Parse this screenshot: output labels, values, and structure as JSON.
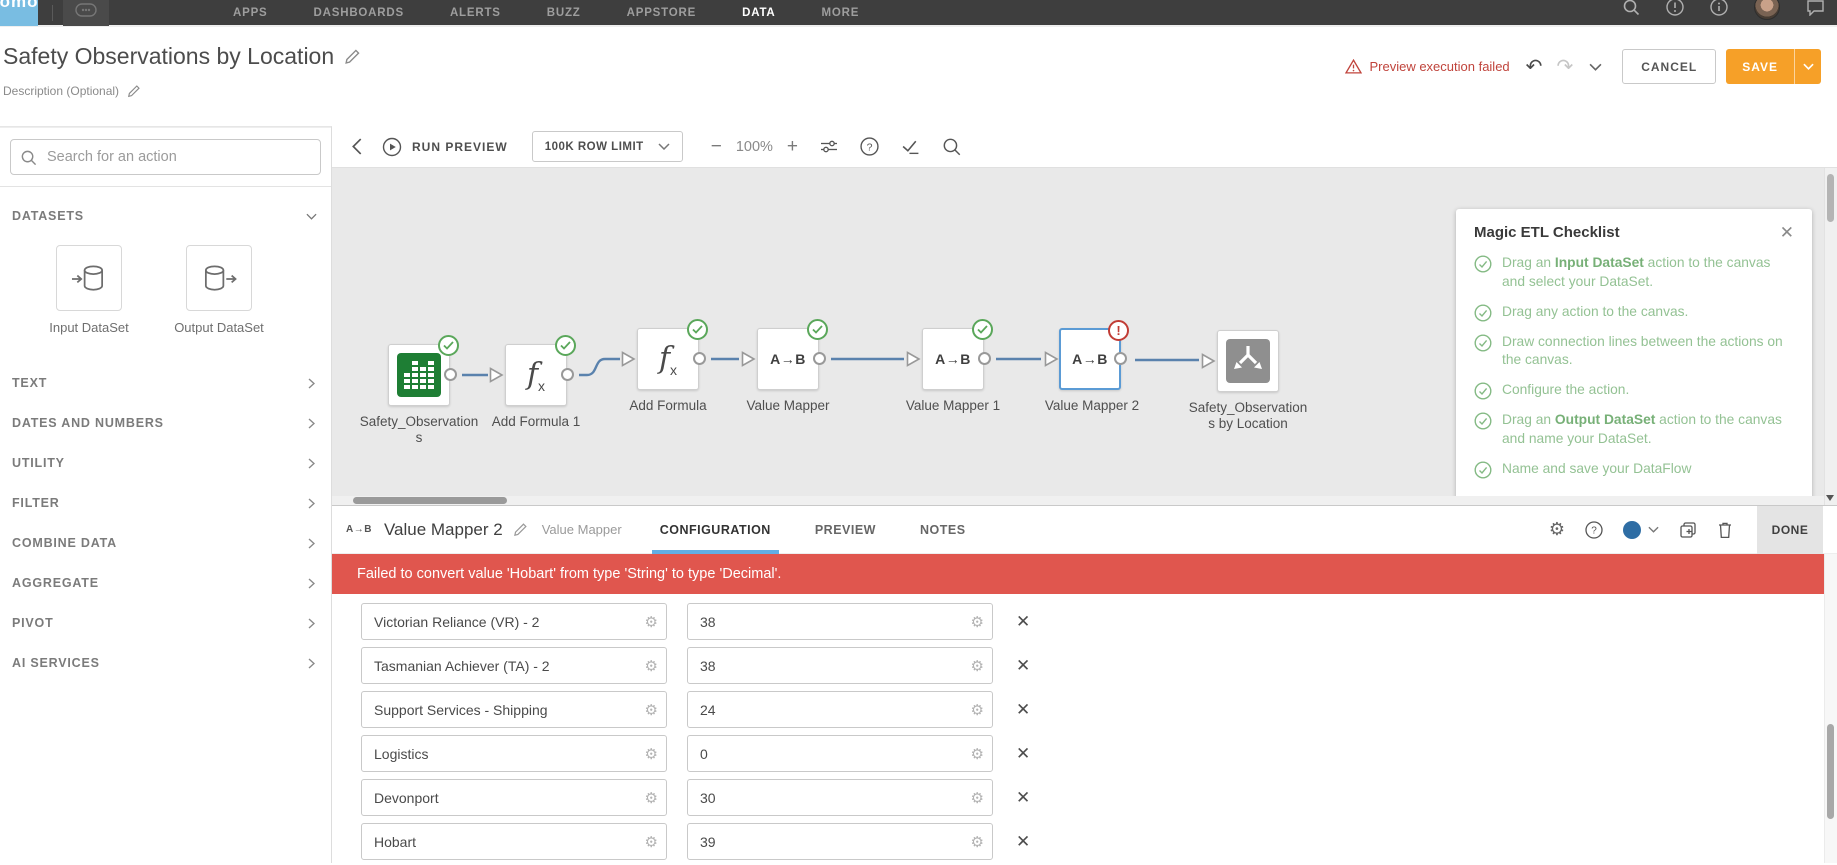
{
  "topnav": {
    "items": [
      {
        "label": "APPS",
        "active": false
      },
      {
        "label": "DASHBOARDS",
        "active": false
      },
      {
        "label": "ALERTS",
        "active": false
      },
      {
        "label": "BUZZ",
        "active": false
      },
      {
        "label": "APPSTORE",
        "active": false
      },
      {
        "label": "DATA",
        "active": true
      },
      {
        "label": "MORE",
        "active": false
      }
    ]
  },
  "header": {
    "title": "Safety Observations by Location",
    "description_label": "Description (Optional)",
    "error_status": "Preview execution failed",
    "cancel_label": "CANCEL",
    "save_label": "SAVE"
  },
  "sidebar": {
    "search_placeholder": "Search for an action",
    "datasets": {
      "label": "DATASETS",
      "tiles": [
        {
          "label": "Input DataSet",
          "type": "input"
        },
        {
          "label": "Output DataSet",
          "type": "output"
        }
      ]
    },
    "sections": [
      "TEXT",
      "DATES AND NUMBERS",
      "UTILITY",
      "FILTER",
      "COMBINE DATA",
      "AGGREGATE",
      "PIVOT",
      "AI SERVICES"
    ]
  },
  "toolbar": {
    "run_preview": "RUN PREVIEW",
    "row_limit": "100K ROW LIMIT",
    "zoom": "100%"
  },
  "canvas": {
    "nodes": [
      {
        "label": "Safety_Observations",
        "type": "input-dataset",
        "status": "success",
        "selected": false
      },
      {
        "label": "Add Formula 1",
        "type": "formula",
        "status": "success",
        "selected": false
      },
      {
        "label": "Add Formula",
        "type": "formula",
        "status": "success",
        "selected": false
      },
      {
        "label": "Value Mapper",
        "type": "value-mapper",
        "status": "success",
        "selected": false
      },
      {
        "label": "Value Mapper 1",
        "type": "value-mapper",
        "status": "success",
        "selected": false
      },
      {
        "label": "Value Mapper 2",
        "type": "value-mapper",
        "status": "error",
        "selected": true
      },
      {
        "label": "Safety_Observations by Location",
        "type": "output-dataset",
        "status": "none",
        "selected": false
      }
    ]
  },
  "checklist": {
    "title": "Magic ETL Checklist",
    "items": [
      {
        "segments": [
          {
            "t": "Drag an ",
            "b": false
          },
          {
            "t": "Input DataSet",
            "b": true
          },
          {
            "t": " action to the canvas and select your DataSet.",
            "b": false
          }
        ]
      },
      {
        "segments": [
          {
            "t": "Drag any action to the canvas.",
            "b": false
          }
        ]
      },
      {
        "segments": [
          {
            "t": "Draw connection lines between the actions on the canvas.",
            "b": false
          }
        ]
      },
      {
        "segments": [
          {
            "t": "Configure the action.",
            "b": false
          }
        ]
      },
      {
        "segments": [
          {
            "t": "Drag an ",
            "b": false
          },
          {
            "t": "Output DataSet",
            "b": true
          },
          {
            "t": " action to the canvas and name your DataSet.",
            "b": false
          }
        ]
      },
      {
        "segments": [
          {
            "t": "Name and save your DataFlow",
            "b": false
          }
        ]
      }
    ]
  },
  "panel": {
    "icon_label": "A→B",
    "title": "Value Mapper 2",
    "subtitle": "Value Mapper",
    "tabs": [
      {
        "label": "CONFIGURATION",
        "active": true
      },
      {
        "label": "PREVIEW",
        "active": false
      },
      {
        "label": "NOTES",
        "active": false
      }
    ],
    "done_label": "DONE",
    "error_message": "Failed to convert value 'Hobart' from type 'String' to type 'Decimal'.",
    "mappings": [
      {
        "from": "Victorian Reliance (VR) - 2",
        "to": "38"
      },
      {
        "from": "Tasmanian Achiever (TA) - 2",
        "to": "38"
      },
      {
        "from": "Support Services - Shipping",
        "to": "24"
      },
      {
        "from": "Logistics",
        "to": "0"
      },
      {
        "from": "Devonport",
        "to": "30"
      },
      {
        "from": "Hobart",
        "to": "39"
      }
    ]
  },
  "colors": {
    "accent_orange": "#f6a028",
    "error_banner_red": "#e0564e",
    "error_text_red": "#c0443c",
    "success_green": "#5aa75a",
    "selection_blue": "#5b9bd5",
    "checklist_green": "#94c294",
    "tab_underline_blue": "#62aee4",
    "node_input_green": "#1e7e34",
    "logo_blue": "#79bde2",
    "connection_blue": "#5a82ad"
  }
}
